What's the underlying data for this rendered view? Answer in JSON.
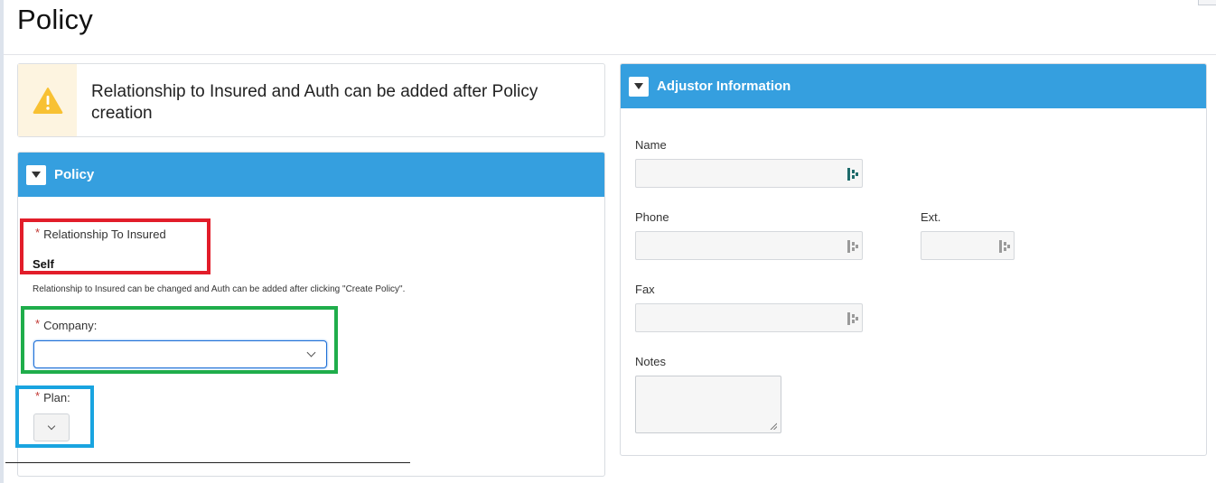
{
  "page": {
    "title": "Policy"
  },
  "notice": {
    "icon": "warning-icon",
    "message": "Relationship to Insured and Auth can be added after Policy creation",
    "accent_color": "#fdf4e0"
  },
  "policy_panel": {
    "title": "Policy",
    "relationship": {
      "label": "Relationship To Insured",
      "value": "Self",
      "help": "Relationship to Insured can be changed and Auth can be added after clicking \"Create Policy\"."
    },
    "company": {
      "label": "Company:",
      "value": ""
    },
    "plan": {
      "label": "Plan:",
      "value": ""
    }
  },
  "adjustor_panel": {
    "title": "Adjustor Information",
    "fields": {
      "name": {
        "label": "Name",
        "value": ""
      },
      "phone": {
        "label": "Phone",
        "value": ""
      },
      "ext": {
        "label": "Ext.",
        "value": ""
      },
      "fax": {
        "label": "Fax",
        "value": ""
      },
      "notes": {
        "label": "Notes",
        "value": ""
      }
    }
  },
  "colors": {
    "header_blue": "#359fdf",
    "required": "#c23934",
    "highlight_red": "#e21d2a",
    "highlight_green": "#1fad4b",
    "highlight_blue": "#19a4e0"
  }
}
